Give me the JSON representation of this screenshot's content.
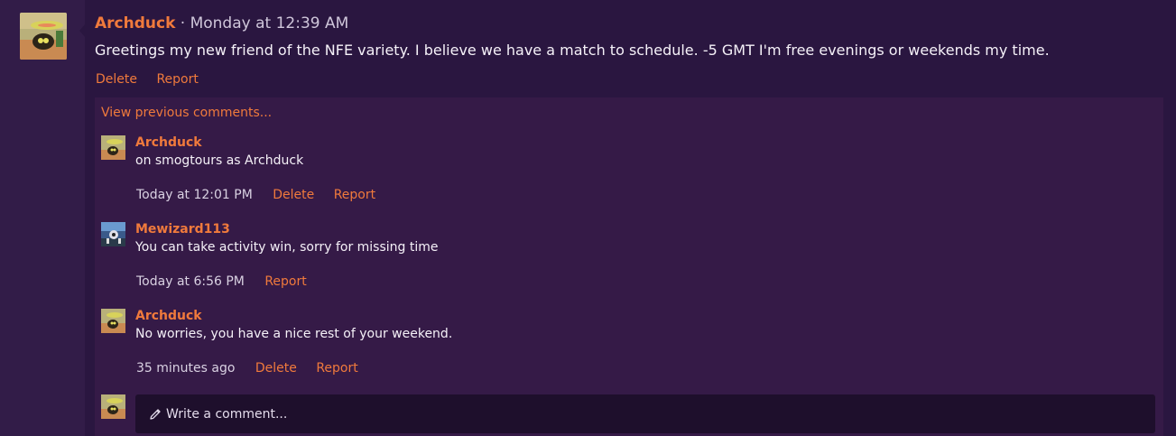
{
  "post": {
    "username": "Archduck",
    "separator": "·",
    "time": "Monday at 12:39 AM",
    "body": "Greetings my new friend of the NFE variety. I believe we have a match to schedule. -5 GMT I'm free evenings or weekends my time.",
    "actions": {
      "delete": "Delete",
      "report": "Report"
    }
  },
  "comments": {
    "view_previous": "View previous comments...",
    "items": [
      {
        "username": "Archduck",
        "text": "on smogtours as Archduck",
        "time": "Today at 12:01 PM",
        "delete": "Delete",
        "report": "Report"
      },
      {
        "username": "Mewizard113",
        "text": "You can take activity win, sorry for missing time",
        "time": "Today at 6:56 PM",
        "report": "Report"
      },
      {
        "username": "Archduck",
        "text": "No worries, you have a nice rest of your weekend.",
        "time": "35 minutes ago",
        "delete": "Delete",
        "report": "Report"
      }
    ],
    "write_placeholder": "Write a comment..."
  },
  "colors": {
    "accent": "#f07a3c",
    "background": "#2a1640",
    "comments_background": "#351a47",
    "input_background": "#1e0f2c"
  }
}
